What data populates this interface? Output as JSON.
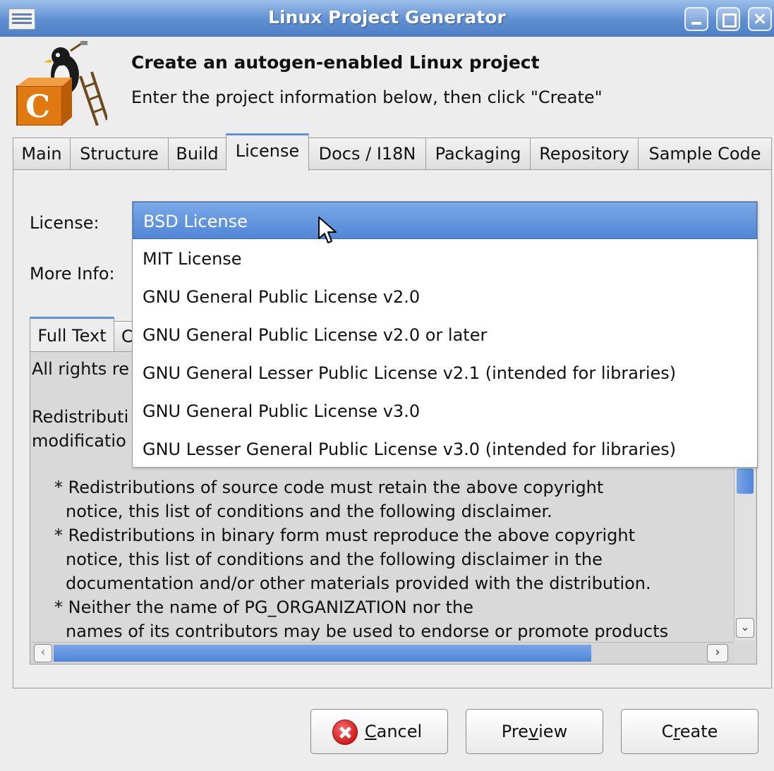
{
  "window": {
    "title": "Linux Project Generator"
  },
  "header": {
    "title": "Create an autogen-enabled Linux project",
    "subtitle": "Enter the project information below, then click \"Create\"",
    "logo_letter": "C"
  },
  "tabs": [
    {
      "label": "Main"
    },
    {
      "label": "Structure"
    },
    {
      "label": "Build"
    },
    {
      "label": "License"
    },
    {
      "label": "Docs / I18N"
    },
    {
      "label": "Packaging"
    },
    {
      "label": "Repository"
    },
    {
      "label": "Sample Code"
    }
  ],
  "active_tab": "License",
  "form": {
    "license_label": "License:",
    "more_info_label": "More Info:"
  },
  "license_dropdown": {
    "selected": "BSD License",
    "options": [
      "BSD License",
      "MIT License",
      "GNU General Public License v2.0",
      "GNU General Public License v2.0 or later",
      "GNU General Lesser Public License v2.1 (intended for libraries)",
      "GNU General Public License v3.0",
      "GNU Lesser General Public License v3.0 (intended for libraries)"
    ]
  },
  "inner_tabs": {
    "full_text": "Full Text",
    "second_partial": "C"
  },
  "license_text": {
    "line_partial_1": "All rights re",
    "line_partial_2": "Redistributi",
    "line_partial_3": "modificatio",
    "lines": [
      "* Redistributions of source code must retain the above copyright",
      "notice, this list of conditions and the following disclaimer.",
      "* Redistributions in binary form must reproduce the above copyright",
      "notice, this list of conditions and the following disclaimer in the",
      "documentation and/or other materials provided with the distribution.",
      "* Neither the name of PG_ORGANIZATION nor the",
      "names of its contributors may be used to endorse or promote products"
    ]
  },
  "buttons": {
    "cancel_prefix": "C",
    "cancel_rest": "ancel",
    "preview_pre": "Pre",
    "preview_mn": "v",
    "preview_post": "iew",
    "create_pre": "C",
    "create_mn": "r",
    "create_post": "eate"
  },
  "colors": {
    "accent": "#5d92d9",
    "selection": "#4f86d6",
    "titlebar": "#5f8fd2"
  }
}
